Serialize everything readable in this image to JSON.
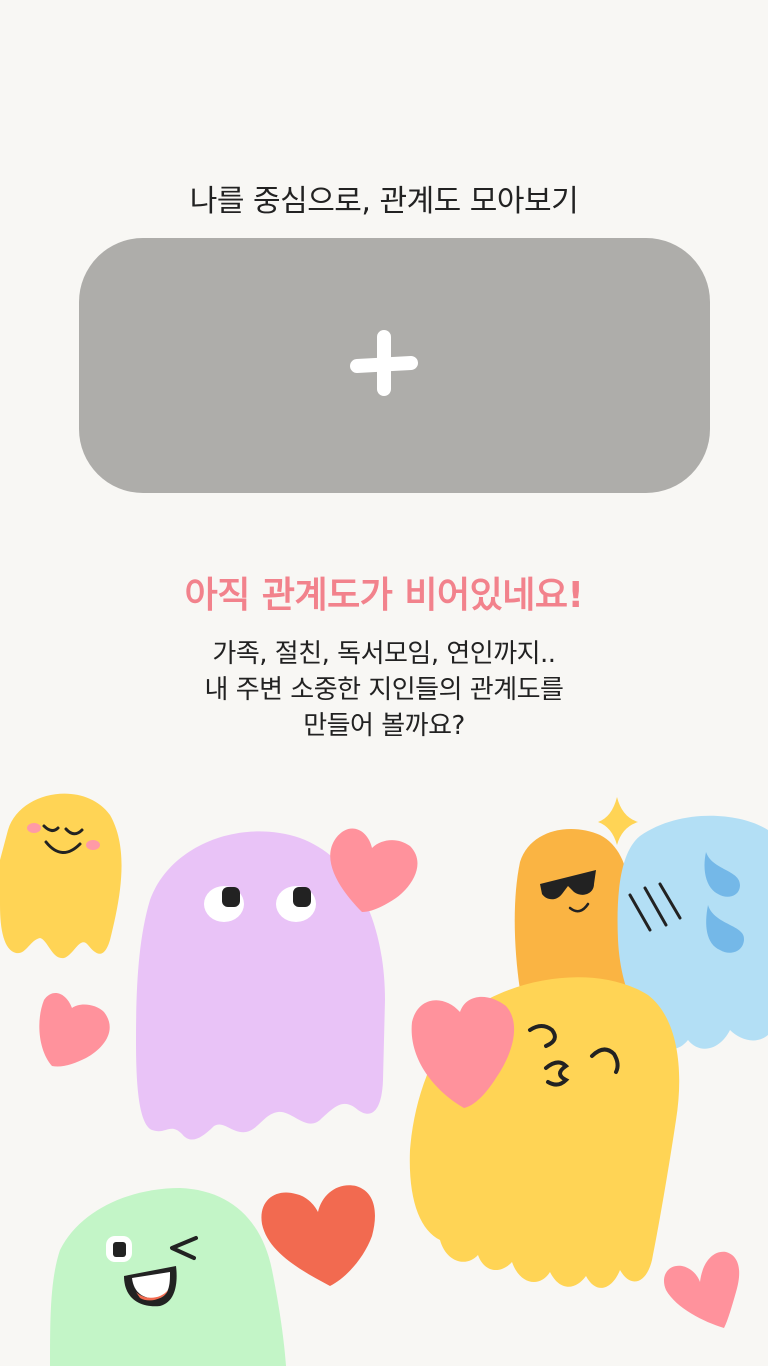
{
  "header": {
    "title": "나를 중심으로, 관계도 모아보기"
  },
  "add_card": {
    "icon": "plus-icon",
    "color": "#aeadaa"
  },
  "empty_state": {
    "title": "아직 관계도가 비어있네요!",
    "title_color": "#f2828c",
    "description_lines": [
      "가족, 절친, 독서모임, 연인까지..",
      "내 주변 소중한 지인들의 관계도를",
      "만들어 볼까요?"
    ]
  },
  "colors": {
    "background": "#f8f7f4",
    "ghost_yellow": "#ffd455",
    "ghost_purple": "#e9c3f7",
    "ghost_orange": "#fab443",
    "ghost_blue": "#b3dff5",
    "ghost_green": "#c3f5c7",
    "heart_pink": "#ff929c",
    "heart_red": "#f26a50"
  }
}
